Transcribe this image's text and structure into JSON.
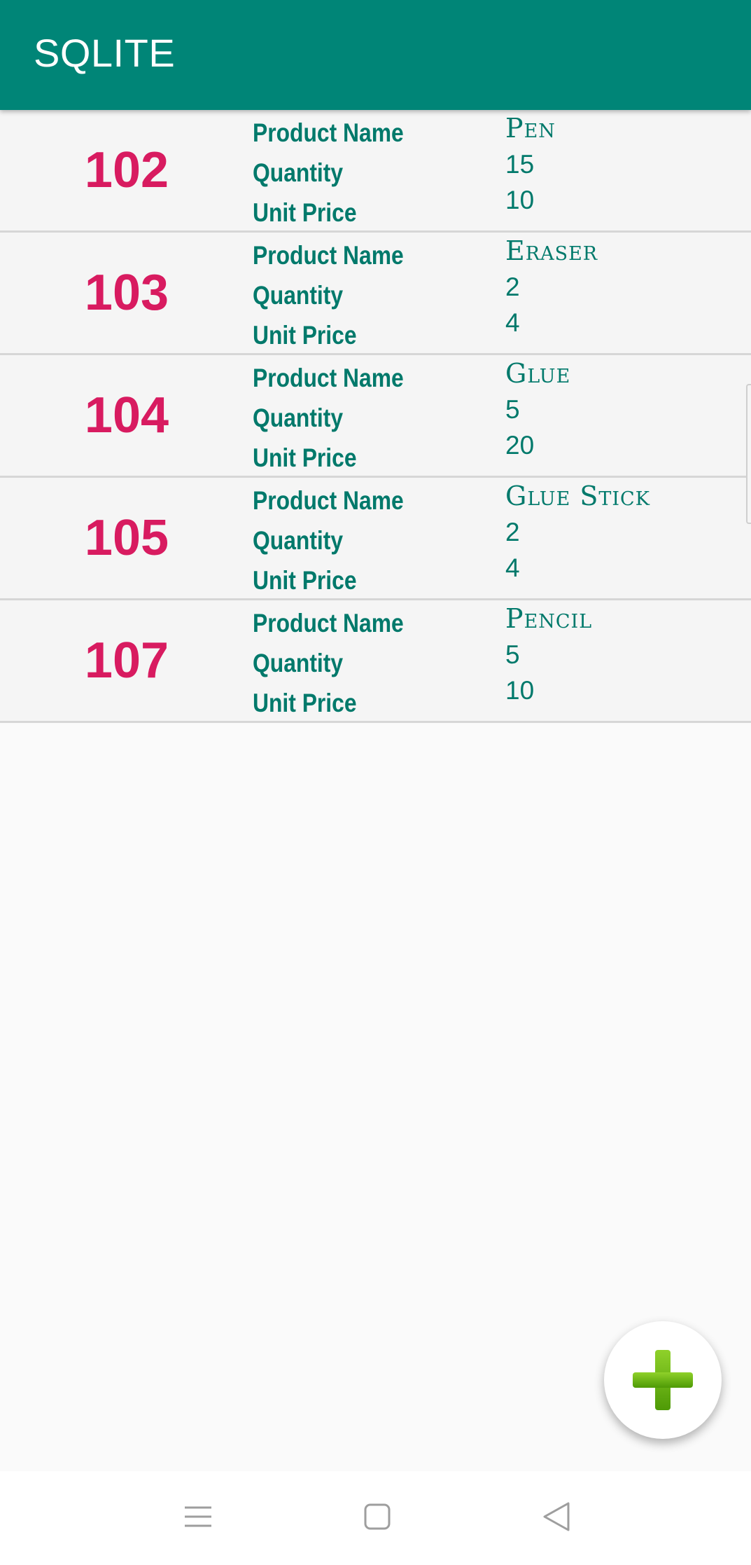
{
  "app_bar": {
    "title": "SQLITE"
  },
  "labels": {
    "product_name": "Product Name",
    "quantity": "Quantity",
    "unit_price": "Unit Price"
  },
  "items": [
    {
      "id": "102",
      "product_name": "Pen",
      "quantity": "15",
      "unit_price": "10"
    },
    {
      "id": "103",
      "product_name": "Eraser",
      "quantity": "2",
      "unit_price": "4"
    },
    {
      "id": "104",
      "product_name": "Glue",
      "quantity": "5",
      "unit_price": "20"
    },
    {
      "id": "105",
      "product_name": "Glue Stick",
      "quantity": "2",
      "unit_price": "4"
    },
    {
      "id": "107",
      "product_name": "Pencil",
      "quantity": "5",
      "unit_price": "10"
    }
  ],
  "fab": {
    "icon": "plus-icon",
    "color": "#6bb512"
  },
  "nav_bar": {
    "icons": [
      "menu-icon",
      "home-square-icon",
      "back-triangle-icon"
    ]
  },
  "colors": {
    "app_bar": "#008577",
    "id_text": "#d81b60",
    "label_text": "#00796b"
  }
}
